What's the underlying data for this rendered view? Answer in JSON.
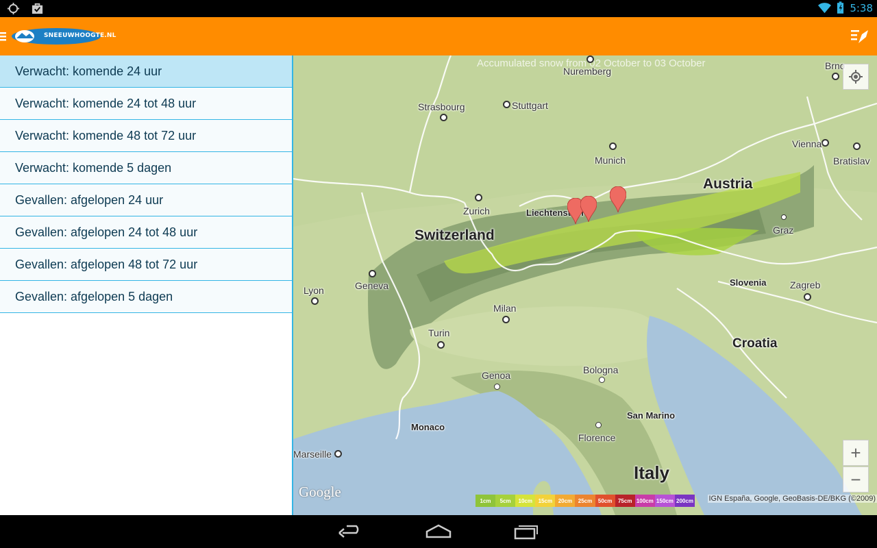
{
  "status_bar": {
    "time": "5:38",
    "left_icons": [
      "sync-icon",
      "shopping-bag-icon"
    ],
    "right_icons": [
      "wifi-icon",
      "battery-icon"
    ]
  },
  "action_bar": {
    "logo_text": "SNEEUWHOOGTE.NL",
    "menu_icon": "hamburger-icon",
    "action_icon": "share-icon",
    "background": "#ff8c00"
  },
  "sidebar": {
    "items": [
      {
        "label": "Verwacht: komende 24 uur",
        "selected": true
      },
      {
        "label": "Verwacht: komende 24 tot 48 uur",
        "selected": false
      },
      {
        "label": "Verwacht: komende 48 tot 72 uur",
        "selected": false
      },
      {
        "label": "Verwacht: komende 5 dagen",
        "selected": false
      },
      {
        "label": "Gevallen: afgelopen 24 uur",
        "selected": false
      },
      {
        "label": "Gevallen: afgelopen 24 tot 48 uur",
        "selected": false
      },
      {
        "label": "Gevallen: afgelopen 48 tot 72 uur",
        "selected": false
      },
      {
        "label": "Gevallen: afgelopen 5 dagen",
        "selected": false
      }
    ],
    "accent": "#33b5e5"
  },
  "map": {
    "overlay_title": "Accumulated snow from 02 October to 03 October",
    "labels": {
      "nuremberg": "Nuremberg",
      "strasbourg": "Strasbourg",
      "stuttgart": "Stuttgart",
      "munich": "Munich",
      "vienna": "Vienna",
      "bratislava": "Bratislav",
      "brno": "Brno",
      "austria": "Austria",
      "zurich": "Zurich",
      "liechtenstein": "Liechtenstein",
      "switzerland": "Switzerland",
      "graz": "Graz",
      "lyon": "Lyon",
      "geneva": "Geneva",
      "slovenia": "Slovenia",
      "zagreb": "Zagreb",
      "milan": "Milan",
      "turin": "Turin",
      "croatia": "Croatia",
      "genoa": "Genoa",
      "bologna": "Bologna",
      "san_marino": "San Marino",
      "monaco": "Monaco",
      "florence": "Florence",
      "marseille": "Marseille",
      "italy": "Italy"
    },
    "legend": [
      {
        "label": "1cm",
        "color": "#8fc43a"
      },
      {
        "label": "5cm",
        "color": "#a6d13c"
      },
      {
        "label": "10cm",
        "color": "#d6e33b"
      },
      {
        "label": "15cm",
        "color": "#f2d23a"
      },
      {
        "label": "20cm",
        "color": "#f2aa33"
      },
      {
        "label": "25cm",
        "color": "#ec8430"
      },
      {
        "label": "50cm",
        "color": "#e0512d"
      },
      {
        "label": "75cm",
        "color": "#b8232a"
      },
      {
        "label": "100cm",
        "color": "#c83ca8"
      },
      {
        "label": "150cm",
        "color": "#b752d6"
      },
      {
        "label": "200cm",
        "color": "#7a35c2"
      }
    ],
    "attribution": "IGN España, Google, GeoBasis-DE/BKG (©2009)",
    "google_logo": "Google",
    "zoom_in": "+",
    "zoom_out": "−",
    "marker_count": 3
  },
  "nav_bar": {
    "buttons": [
      "back-icon",
      "home-icon",
      "recent-apps-icon"
    ]
  }
}
